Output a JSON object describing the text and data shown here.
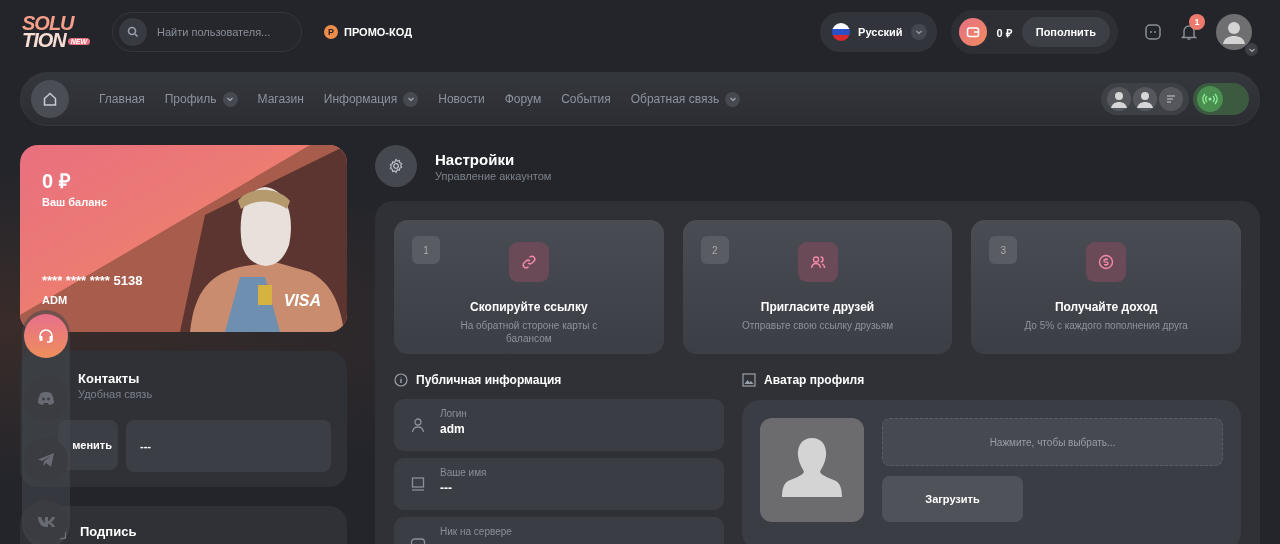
{
  "header": {
    "logo": {
      "line1": "SOLU",
      "line2": "TION",
      "badge": "NEW"
    },
    "search": {
      "placeholder": "Найти пользователя..."
    },
    "promo": {
      "icon": "Р",
      "label": "ПРОМО-КОД"
    },
    "language": {
      "label": "Русский"
    },
    "balance": {
      "amount": "0 ₽",
      "button": "Пополнить"
    },
    "notifications": {
      "count": "1"
    }
  },
  "nav": {
    "items": [
      {
        "label": "Главная",
        "dropdown": false
      },
      {
        "label": "Профиль",
        "dropdown": true
      },
      {
        "label": "Магазин",
        "dropdown": false
      },
      {
        "label": "Информация",
        "dropdown": true
      },
      {
        "label": "Новости",
        "dropdown": false
      },
      {
        "label": "Форум",
        "dropdown": false
      },
      {
        "label": "События",
        "dropdown": false
      },
      {
        "label": "Обратная связь",
        "dropdown": true
      }
    ]
  },
  "balance_card": {
    "amount": "0 ₽",
    "caption": "Ваш баланс",
    "number": "**** **** **** 5138",
    "holder": "ADM",
    "brand": "VISA"
  },
  "contacts": {
    "title": "Контакты",
    "subtitle": "Удобная связь",
    "button": "менить",
    "value": "---"
  },
  "signature": {
    "title": "Подпись"
  },
  "social_dock": [
    {
      "kind": "support",
      "active": true
    },
    {
      "kind": "discord",
      "active": false
    },
    {
      "kind": "telegram",
      "active": false
    },
    {
      "kind": "vk",
      "active": false
    }
  ],
  "settings": {
    "title": "Настройки",
    "subtitle": "Управление аккаунтом",
    "steps": [
      {
        "number": "1",
        "kind": "link",
        "title": "Скопируйте ссылку",
        "text": "На обратной стороне карты с балансом"
      },
      {
        "number": "2",
        "kind": "users",
        "title": "Пригласите друзей",
        "text": "Отправьте свою ссылку друзьям"
      },
      {
        "number": "3",
        "kind": "coin",
        "title": "Получайте доход",
        "text": "До 5% с каждого пополнения друга"
      }
    ],
    "public_info": {
      "title": "Публичная информация",
      "fields": [
        {
          "kind": "user",
          "label": "Логин",
          "value": "adm"
        },
        {
          "kind": "monitor",
          "label": "Ваше имя",
          "value": "---"
        },
        {
          "kind": "game",
          "label": "Ник на сервере"
        }
      ]
    },
    "avatar": {
      "title": "Аватар профиля",
      "picker": "Нажмите, чтобы выбрать...",
      "button": "Загрузить"
    }
  }
}
